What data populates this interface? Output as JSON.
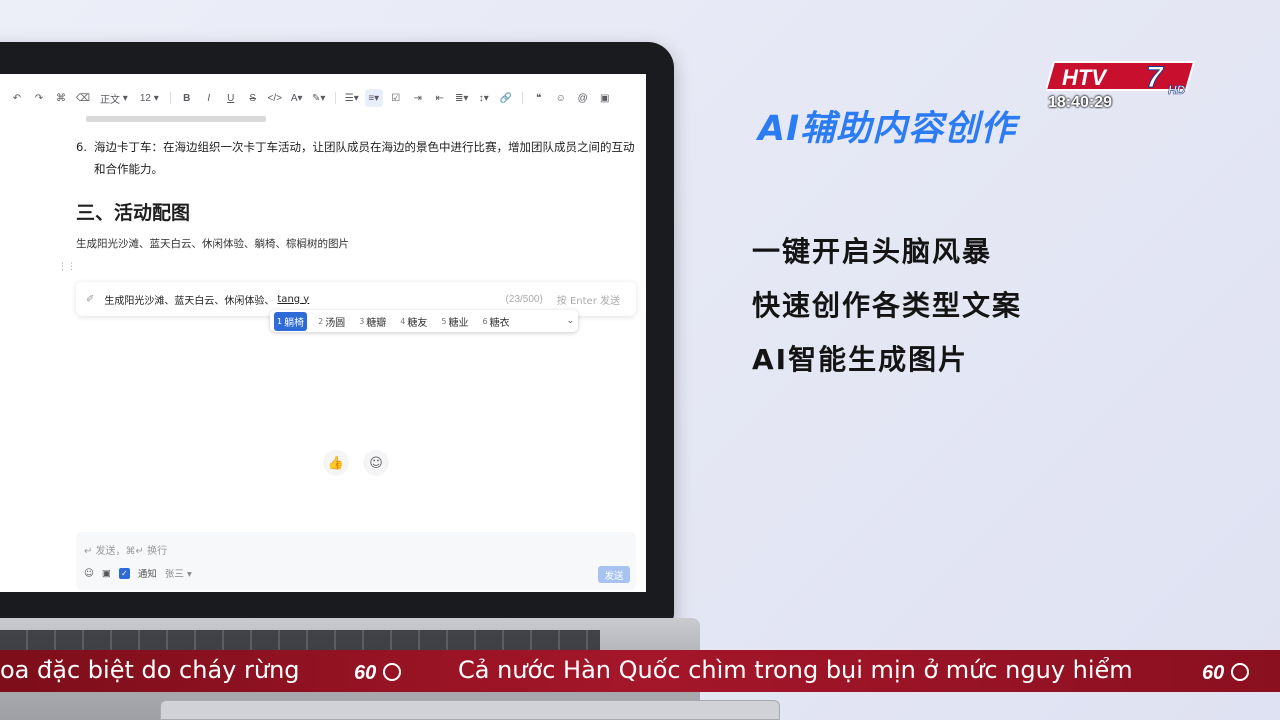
{
  "overlay": {
    "channel_logo": "HTV7 HD",
    "clock": "18:40:29"
  },
  "toolbar": {
    "style_label": "正文",
    "font_size": "12"
  },
  "document": {
    "list_item_number": "6.",
    "list_item_text": "海边卡丁车：在海边组织一次卡丁车活动，让团队成员在海边的景色中进行比赛，增加团队成员之间的互动和合作能力。",
    "section_heading": "三、活动配图",
    "paragraph": "生成阳光沙滩、蓝天白云、休闲体验、躺椅、棕榈树的图片"
  },
  "ai_input": {
    "text": "生成阳光沙滩、蓝天白云、休闲体验、",
    "typing": "tang y",
    "counter": "(23/500)",
    "send_hint": "按 Enter 发送"
  },
  "ime": {
    "candidates": [
      {
        "num": "1",
        "word": "躺椅"
      },
      {
        "num": "2",
        "word": "汤圆"
      },
      {
        "num": "3",
        "word": "糖瓣"
      },
      {
        "num": "4",
        "word": "糖友"
      },
      {
        "num": "5",
        "word": "糖业"
      },
      {
        "num": "6",
        "word": "糖衣"
      }
    ]
  },
  "comment": {
    "placeholder": "↵ 发送，⌘↵ 换行",
    "notify_label": "通知",
    "notify_user": "张三",
    "send_label": "发送"
  },
  "promo": {
    "headline": "AI辅助内容创作",
    "features": [
      "一键开启头脑风暴",
      "快速创作各类型文案",
      "AI智能生成图片"
    ]
  },
  "ticker": {
    "left_text": "oa đặc biệt do cháy rừng",
    "main_text": "Cả nước Hàn Quốc chìm trong bụi mịn ở mức nguy hiểm"
  },
  "colors": {
    "accent_blue": "#2a7bf4",
    "ticker_red": "#a5162a",
    "selected_candidate": "#2e6bd9"
  }
}
